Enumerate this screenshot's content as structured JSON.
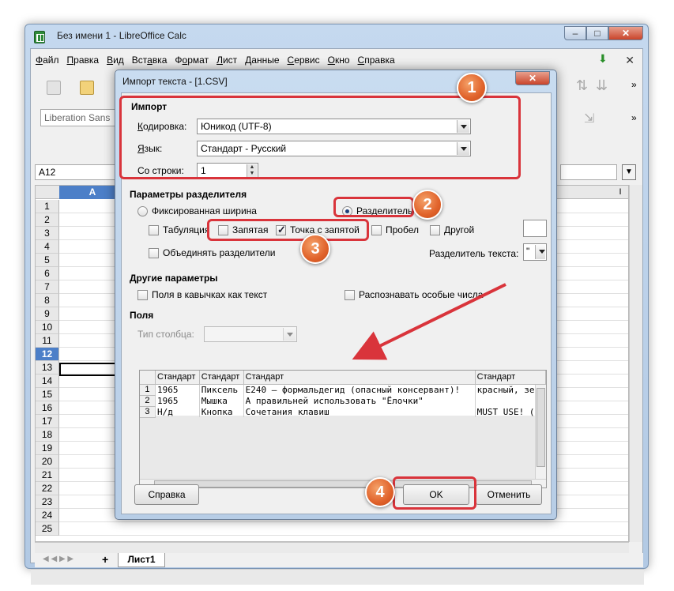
{
  "window": {
    "title": "Без имени 1 - LibreOffice Calc",
    "min": "–",
    "max": "□",
    "close": "✕"
  },
  "menu": [
    {
      "pre": "",
      "u": "Ф",
      "post": "айл"
    },
    {
      "pre": "",
      "u": "П",
      "post": "равка"
    },
    {
      "pre": "",
      "u": "В",
      "post": "ид"
    },
    {
      "pre": "Вст",
      "u": "а",
      "post": "вка"
    },
    {
      "pre": "Ф",
      "u": "о",
      "post": "рмат"
    },
    {
      "pre": "",
      "u": "Л",
      "post": "ист"
    },
    {
      "pre": "",
      "u": "Д",
      "post": "анные"
    },
    {
      "pre": "",
      "u": "С",
      "post": "ервис"
    },
    {
      "pre": "",
      "u": "О",
      "post": "кно"
    },
    {
      "pre": "",
      "u": "С",
      "post": "правка"
    }
  ],
  "menu_close": "✕",
  "font_name": "Liberation Sans",
  "name_box": "A12",
  "grid": {
    "col_a": "A",
    "col_i": "I",
    "rows": [
      "1",
      "2",
      "3",
      "4",
      "5",
      "6",
      "7",
      "8",
      "9",
      "10",
      "11",
      "12",
      "13",
      "14",
      "15",
      "16",
      "17",
      "18",
      "19",
      "20",
      "21",
      "22",
      "23",
      "24",
      "25"
    ],
    "selected_row": "12"
  },
  "sheet_tab": "Лист1",
  "sheet_add": "+",
  "dialog": {
    "title": "Импорт текста - [1.CSV]",
    "close": "✕",
    "import": {
      "title": "Импорт",
      "encoding_label_u": "К",
      "encoding_label": "одировка:",
      "encoding_value": "Юникод (UTF-8)",
      "language_label_u": "Я",
      "language_label": "зык:",
      "language_value": "Стандарт - Русский",
      "from_row_label": "Со строки:",
      "from_row_u": "т",
      "from_row_value": "1"
    },
    "separator": {
      "title": "Параметры разделителя",
      "fixed_width": "Фиксированная ширина",
      "separated": "Разделитель",
      "tab": "Табуляция",
      "comma": "Запятая",
      "semicolon": "Точка с запятой",
      "space": "Пробел",
      "other": "Другой",
      "merge": "Объединять разделители",
      "text_delim_label": "Разделитель текста:",
      "text_delim_value": "\""
    },
    "other": {
      "title": "Другие параметры",
      "quoted_as_text": "Поля в кавычках как текст",
      "detect_special": "Распознавать особые числа"
    },
    "fields": {
      "title": "Поля",
      "column_type_label": "Тип столбца:",
      "headers": [
        "Стандарт",
        "Стандарт",
        "Стандарт",
        "Стандарт"
      ],
      "rows": [
        {
          "n": "1",
          "c1": "1965",
          "c2": "Пиксель",
          "c3": "E240 – формальдегид (опасный консервант)!",
          "c4": "красный, зе"
        },
        {
          "n": "2",
          "c1": "1965",
          "c2": "Мышка",
          "c3": "А правильней использовать \"Ёлочки\"",
          "c4": ""
        },
        {
          "n": "3",
          "c1": "Н/д",
          "c2": "Кнопка",
          "c3": "Сочетания клавиш",
          "c4": "MUST USE! ("
        }
      ]
    },
    "buttons": {
      "help": "Справка",
      "ok": "OK",
      "cancel": "Отменить"
    }
  },
  "badges": [
    "1",
    "2",
    "3",
    "4"
  ],
  "colors": {
    "accent": "#4c7fc8",
    "highlight": "#d9343b",
    "badge": "#e0622a"
  }
}
